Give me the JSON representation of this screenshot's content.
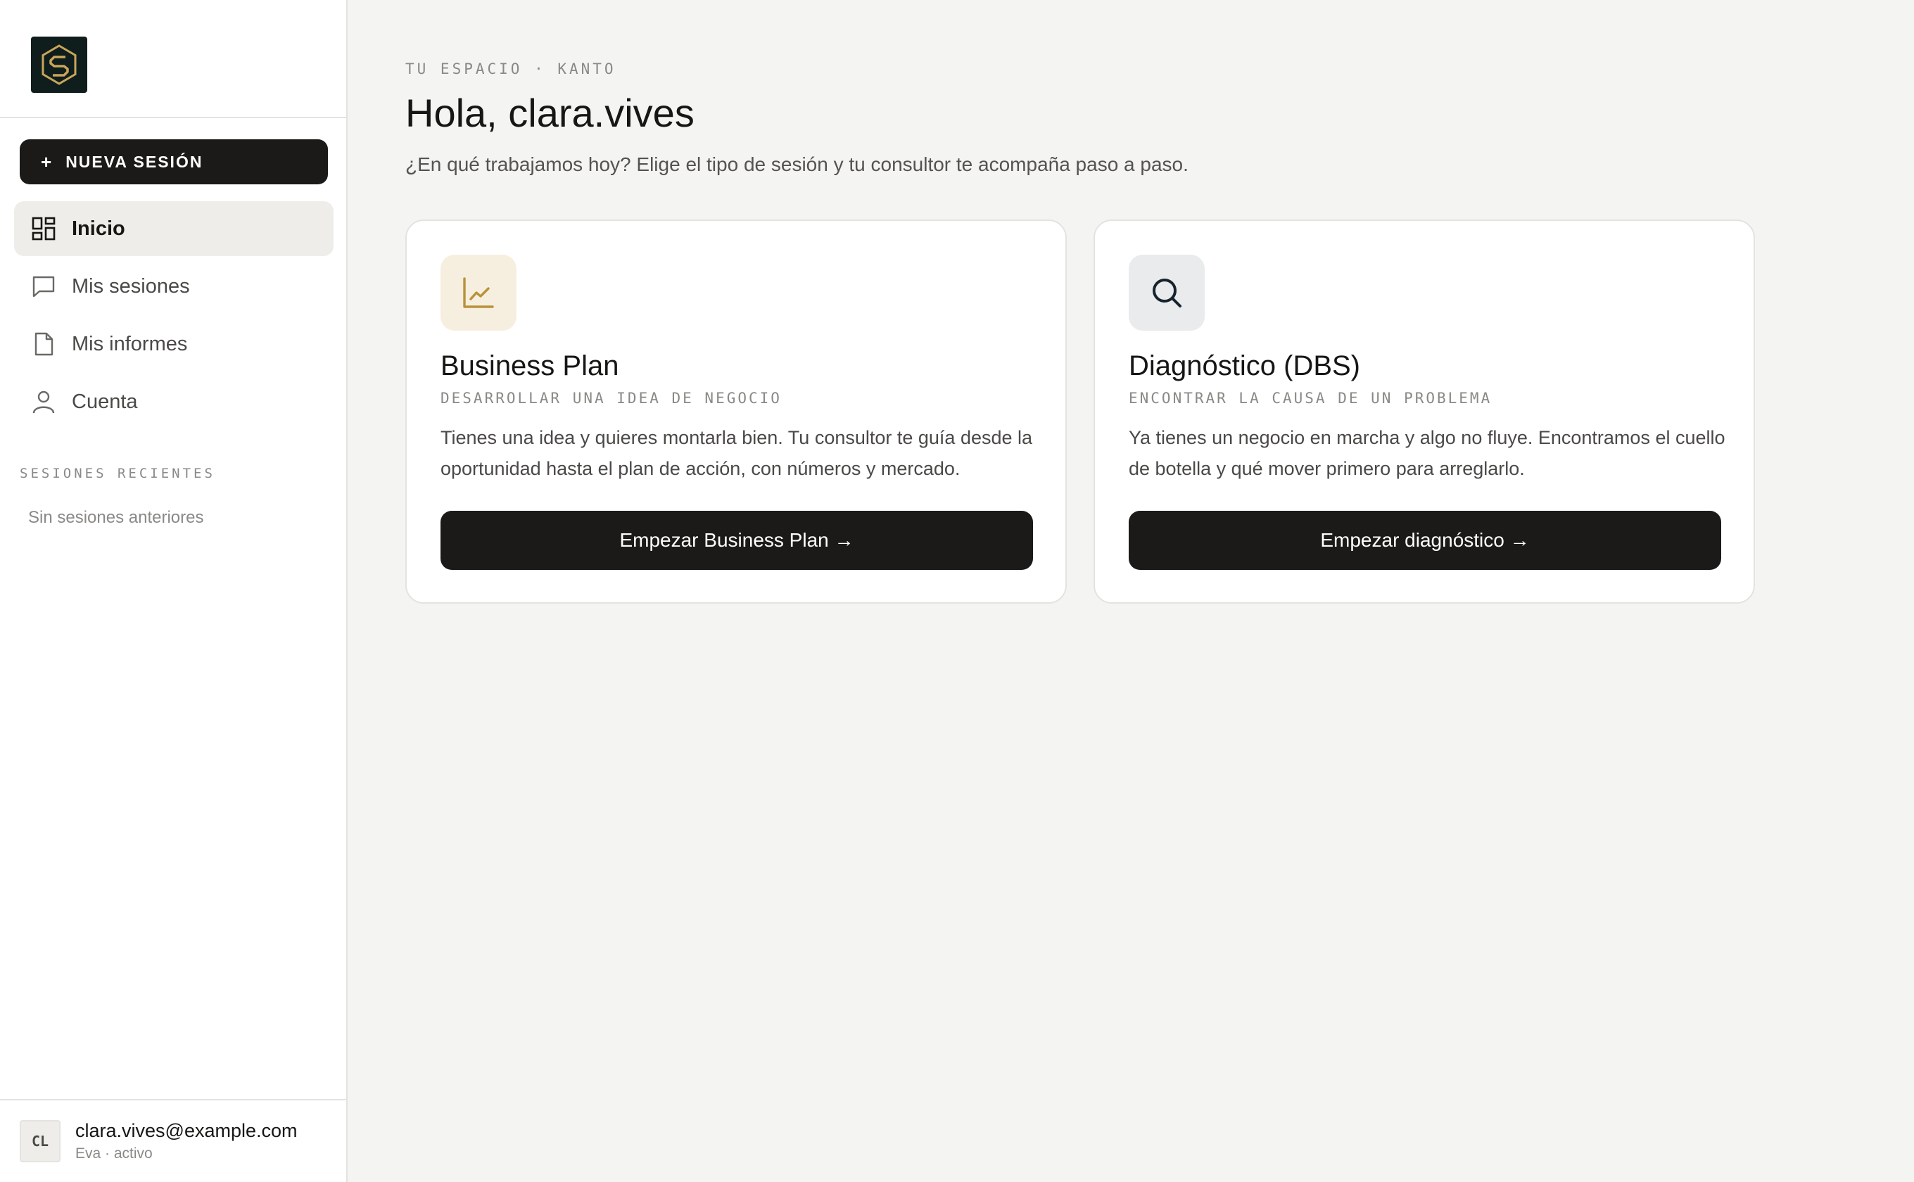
{
  "sidebar": {
    "new_session_label": "NUEVA SESIÓN",
    "nav": [
      {
        "label": "Inicio",
        "icon": "dashboard-icon",
        "active": true
      },
      {
        "label": "Mis sesiones",
        "icon": "chat-bubble-icon",
        "active": false
      },
      {
        "label": "Mis informes",
        "icon": "document-icon",
        "active": false
      },
      {
        "label": "Cuenta",
        "icon": "user-icon",
        "active": false
      }
    ],
    "recent_label": "SESIONES RECIENTES",
    "recent_empty": "Sin sesiones anteriores",
    "user": {
      "initials": "CL",
      "email": "clara.vives@example.com",
      "status": "Eva · activo"
    }
  },
  "main": {
    "kicker": "TU ESPACIO · KANTO",
    "title": "Hola, clara.vives",
    "subtitle": "¿En qué trabajamos hoy? Elige el tipo de sesión y tu consultor te acompaña paso a paso.",
    "cards": [
      {
        "icon": "chart-icon",
        "title": "Business Plan",
        "tag": "DESARROLLAR UNA IDEA DE NEGOCIO",
        "description": "Tienes una idea y quieres montarla bien. Tu consultor te guía desde la oportunidad hasta el plan de acción, con números y mercado.",
        "button": "Empezar Business Plan →"
      },
      {
        "icon": "search-icon",
        "title": "Diagnóstico (DBS)",
        "tag": "ENCONTRAR LA CAUSA DE UN PROBLEMA",
        "description": "Ya tienes un negocio en marcha y algo no fluye. Encontramos el cuello de botella y qué mover primero para arreglarlo.",
        "button": "Empezar diagnóstico →"
      }
    ]
  },
  "colors": {
    "background": "#f4f4f2",
    "primary_button": "#1b1a18",
    "logo_bg": "#0f1d1c",
    "logo_gold": "#c9a55a",
    "accent_gold": "#b8923a",
    "card1_icon_bg": "#f6efdf",
    "card2_icon_bg": "#e9ebec",
    "card2_icon": "#17242e"
  }
}
